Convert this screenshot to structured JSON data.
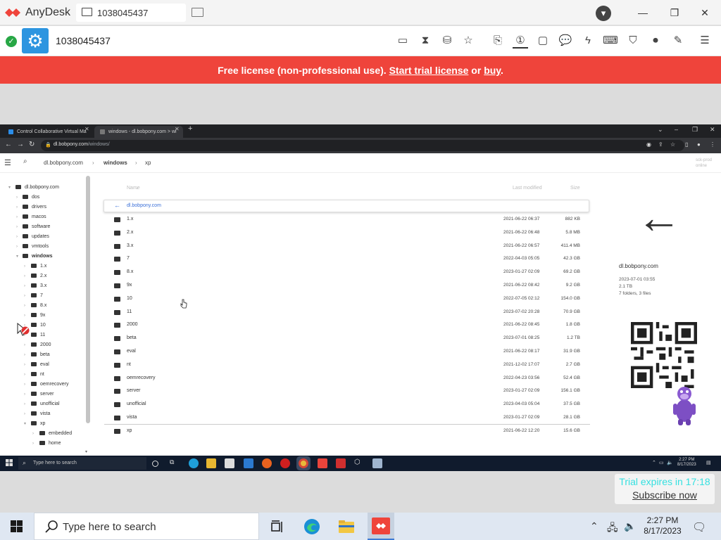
{
  "app": {
    "name": "AnyDesk",
    "tab_label": "1038045437",
    "connection_id": "1038045437"
  },
  "banner": {
    "prefix": "Free license (non-professional use). ",
    "trial_link": "Start trial license",
    "middle": " or ",
    "buy_link": "buy",
    "suffix": "."
  },
  "browser": {
    "tabs": [
      {
        "label": "Control Collaborative Virtual Ma",
        "favicon_color": "#2b8de8"
      },
      {
        "label": "windows - dl.bobpony.com > wi",
        "favicon_color": "#777777"
      }
    ],
    "url_host": "dl.bobpony.com",
    "url_path": "/windows/"
  },
  "site": {
    "breadcrumb": [
      "dl.bobpony.com",
      "windows",
      "xp"
    ],
    "topright_hint": [
      "sck-prod",
      "online"
    ],
    "tree": [
      {
        "label": "dl.bobpony.com",
        "level": 0,
        "expanded": true
      },
      {
        "label": "dos",
        "level": 1
      },
      {
        "label": "drivers",
        "level": 1
      },
      {
        "label": "macos",
        "level": 1
      },
      {
        "label": "software",
        "level": 1
      },
      {
        "label": "updates",
        "level": 1
      },
      {
        "label": "vmtools",
        "level": 1
      },
      {
        "label": "windows",
        "level": 1,
        "expanded": true,
        "bold": true
      },
      {
        "label": "1.x",
        "level": 2
      },
      {
        "label": "2.x",
        "level": 2
      },
      {
        "label": "3.x",
        "level": 2
      },
      {
        "label": "7",
        "level": 2
      },
      {
        "label": "8.x",
        "level": 2
      },
      {
        "label": "9x",
        "level": 2
      },
      {
        "label": "10",
        "level": 2
      },
      {
        "label": "11",
        "level": 2
      },
      {
        "label": "2000",
        "level": 2
      },
      {
        "label": "beta",
        "level": 2
      },
      {
        "label": "eval",
        "level": 2
      },
      {
        "label": "nt",
        "level": 2
      },
      {
        "label": "oemrecovery",
        "level": 2
      },
      {
        "label": "server",
        "level": 2
      },
      {
        "label": "unofficial",
        "level": 2
      },
      {
        "label": "vista",
        "level": 2
      },
      {
        "label": "xp",
        "level": 2,
        "expanded": true
      },
      {
        "label": "embedded",
        "level": 3
      },
      {
        "label": "home",
        "level": 3
      }
    ],
    "columns": {
      "name": "Name",
      "modified": "Last modified",
      "size": "Size"
    },
    "parent_dir": "dl.bobpony.com",
    "files": [
      {
        "name": "1.x",
        "date": "2021-06-22 06:37",
        "size": "882 KB"
      },
      {
        "name": "2.x",
        "date": "2021-06-22 06:48",
        "size": "5.8 MB"
      },
      {
        "name": "3.x",
        "date": "2021-06-22 06:57",
        "size": "411.4 MB"
      },
      {
        "name": "7",
        "date": "2022-04-03 05:05",
        "size": "42.3 GB"
      },
      {
        "name": "8.x",
        "date": "2023-01-27 02:09",
        "size": "69.2 GB"
      },
      {
        "name": "9x",
        "date": "2021-06-22 08:42",
        "size": "9.2 GB"
      },
      {
        "name": "10",
        "date": "2022-07-05 02:12",
        "size": "154.0 GB"
      },
      {
        "name": "11",
        "date": "2023-07-02 20:28",
        "size": "70.9 GB"
      },
      {
        "name": "2000",
        "date": "2021-06-22 08:45",
        "size": "1.8 GB"
      },
      {
        "name": "beta",
        "date": "2023-07-01 08:25",
        "size": "1.2 TB"
      },
      {
        "name": "eval",
        "date": "2021-06-22 08:17",
        "size": "31.9 GB"
      },
      {
        "name": "nt",
        "date": "2021-12-02 17:07",
        "size": "2.7 GB"
      },
      {
        "name": "oemrecovery",
        "date": "2022-04-23 03:56",
        "size": "52.4 GB"
      },
      {
        "name": "server",
        "date": "2023-01-27 02:09",
        "size": "156.1 GB"
      },
      {
        "name": "unofficial",
        "date": "2023-04-03 05:04",
        "size": "37.5 GB"
      },
      {
        "name": "vista",
        "date": "2023-01-27 02:09",
        "size": "28.1 GB"
      },
      {
        "name": "xp",
        "date": "2021-06-22 12:20",
        "size": "15.6 GB"
      }
    ],
    "detail": {
      "name": "dl.bobpony.com",
      "date": "2023-07-01 03:55",
      "size": "2.1 TB",
      "contents": "7 folders, 3 files"
    }
  },
  "remote_taskbar": {
    "search_placeholder": "Type here to search",
    "time": "2:27 PM",
    "date": "8/17/2023"
  },
  "trial": {
    "expires": "Trial expires in 17:18",
    "subscribe": "Subscribe now"
  },
  "taskbar": {
    "search_placeholder": "Type here to search",
    "time": "2:27 PM",
    "date": "8/17/2023"
  },
  "colors": {
    "banner": "#ef443b",
    "anydesk_red": "#ef443b",
    "accent_blue": "#2d95e0",
    "status_green": "#27a745",
    "trial_cyan": "#35e0e0"
  }
}
